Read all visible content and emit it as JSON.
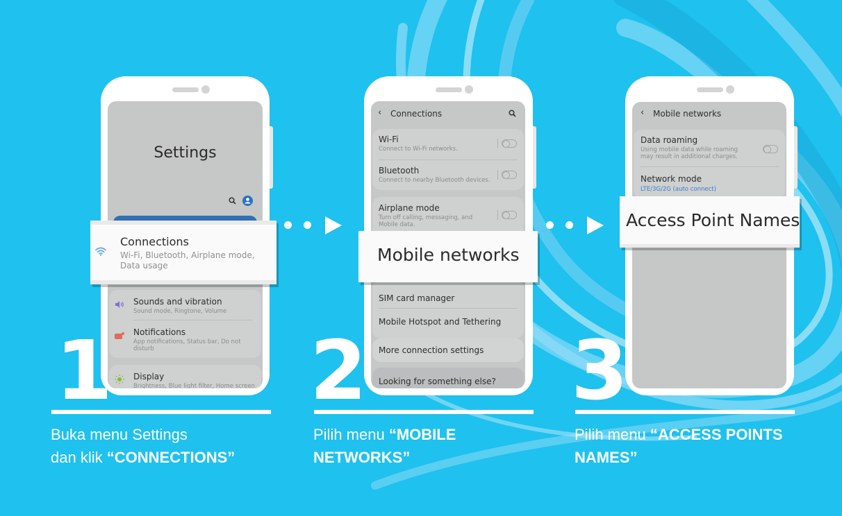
{
  "colors": {
    "background": "#1fc1ee",
    "swirl": "#7fd7f5",
    "screen": "#c6c7c7",
    "accent_blue": "#2a73c4",
    "link_blue": "#3a7fcf"
  },
  "steps": [
    {
      "number": "1",
      "instruction_plain_line1": "Buka menu Settings",
      "instruction_plain_line2": "dan klik ",
      "instruction_bold": "“CONNECTIONS”",
      "phone": {
        "title": "Settings",
        "icons": [
          "search-icon",
          "profile-icon"
        ],
        "callout": {
          "icon": "wifi-icon",
          "title": "Connections",
          "subtitle": "Wi-Fi, Bluetooth, Airplane mode, Data usage"
        },
        "items": [
          {
            "icon": "volume-icon",
            "title": "Sounds and vibration",
            "subtitle": "Sound mode, Ringtone, Volume"
          },
          {
            "icon": "notification-icon",
            "title": "Notifications",
            "subtitle": "App notifications, Status bar, Do not disturb"
          },
          {
            "icon": "brightness-icon",
            "title": "Display",
            "subtitle": "Brightness, Blue light filter, Home screen"
          }
        ]
      }
    },
    {
      "number": "2",
      "instruction_plain": "Pilih menu ",
      "instruction_bold_line1": "“MOBILE",
      "instruction_bold_line2": "NETWORKS”",
      "phone": {
        "header": "Connections",
        "back_icon": "chevron-left-icon",
        "search_icon": "search-icon",
        "items": [
          {
            "title": "Wi-Fi",
            "subtitle": "Connect to Wi-Fi networks.",
            "toggle": false
          },
          {
            "title": "Bluetooth",
            "subtitle": "Connect to nearby Bluetooth devices.",
            "toggle": false
          },
          {
            "title": "Airplane mode",
            "subtitle": "Turn off calling, messaging, and Mobile data.",
            "toggle": false
          }
        ],
        "callout": {
          "title": "Mobile networks"
        },
        "more_items": [
          {
            "title": "SIM card manager"
          },
          {
            "title": "Mobile Hotspot and Tethering"
          },
          {
            "title": "More connection settings"
          },
          {
            "title": "Looking for something else?"
          }
        ]
      }
    },
    {
      "number": "3",
      "instruction_plain": "Pilih menu ",
      "instruction_bold_line1": "“ACCESS POINTS",
      "instruction_bold_line2": "NAMES”",
      "phone": {
        "header": "Mobile networks",
        "back_icon": "chevron-left-icon",
        "items": [
          {
            "title": "Data roaming",
            "subtitle": "Using mobile data while roaming may result in additional charges.",
            "toggle": false
          },
          {
            "title": "Network mode",
            "value": "LTE/3G/2G (auto connect)"
          }
        ],
        "callout": {
          "title": "Access Point Names"
        }
      }
    }
  ]
}
